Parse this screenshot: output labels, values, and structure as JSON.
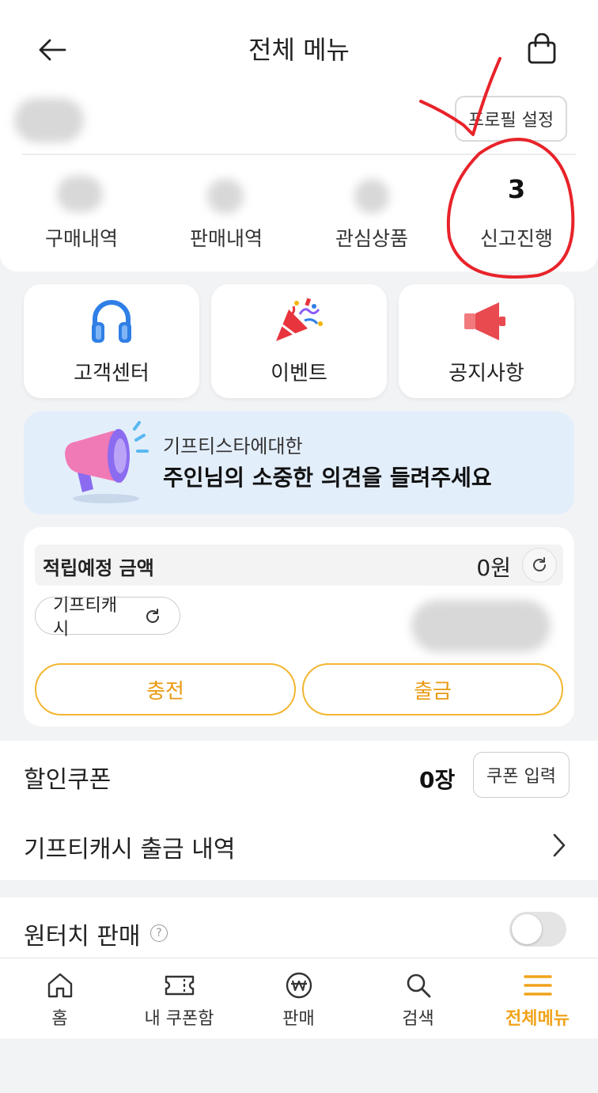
{
  "header": {
    "title": "전체 메뉴"
  },
  "profile": {
    "settings_label": "프로필 설정"
  },
  "stats": [
    {
      "label": "구매내역",
      "count": ""
    },
    {
      "label": "판매내역",
      "count": ""
    },
    {
      "label": "관심상품",
      "count": ""
    },
    {
      "label": "신고진행",
      "count": "3"
    }
  ],
  "tiles": [
    {
      "label": "고객센터",
      "icon": "headphones-icon"
    },
    {
      "label": "이벤트",
      "icon": "party-popper-icon"
    },
    {
      "label": "공지사항",
      "icon": "megaphone-icon"
    }
  ],
  "banner": {
    "subtitle": "기프티스타에대한",
    "title": "주인님의 소중한 의견을 들려주세요"
  },
  "points": {
    "label": "적립예정 금액",
    "value": "0원",
    "cash_label": "기프티캐시",
    "charge_label": "충전",
    "withdraw_label": "출금"
  },
  "coupon": {
    "title": "할인쿠폰",
    "count": "0장",
    "input_label": "쿠폰 입력"
  },
  "cash_history": {
    "title": "기프티캐시 출금 내역"
  },
  "onetouch": {
    "title": "원터치 판매",
    "help": "?",
    "enabled": false
  },
  "bottom_nav": [
    {
      "label": "홈",
      "icon": "home-icon"
    },
    {
      "label": "내 쿠폰함",
      "icon": "ticket-icon"
    },
    {
      "label": "판매",
      "icon": "won-coin-icon"
    },
    {
      "label": "검색",
      "icon": "search-icon"
    },
    {
      "label": "전체메뉴",
      "icon": "menu-icon",
      "active": true
    }
  ],
  "colors": {
    "accent": "#f0a31a",
    "button_border": "#f2b630",
    "banner_bg": "#e3eefb",
    "annotation": "#e8232a"
  }
}
